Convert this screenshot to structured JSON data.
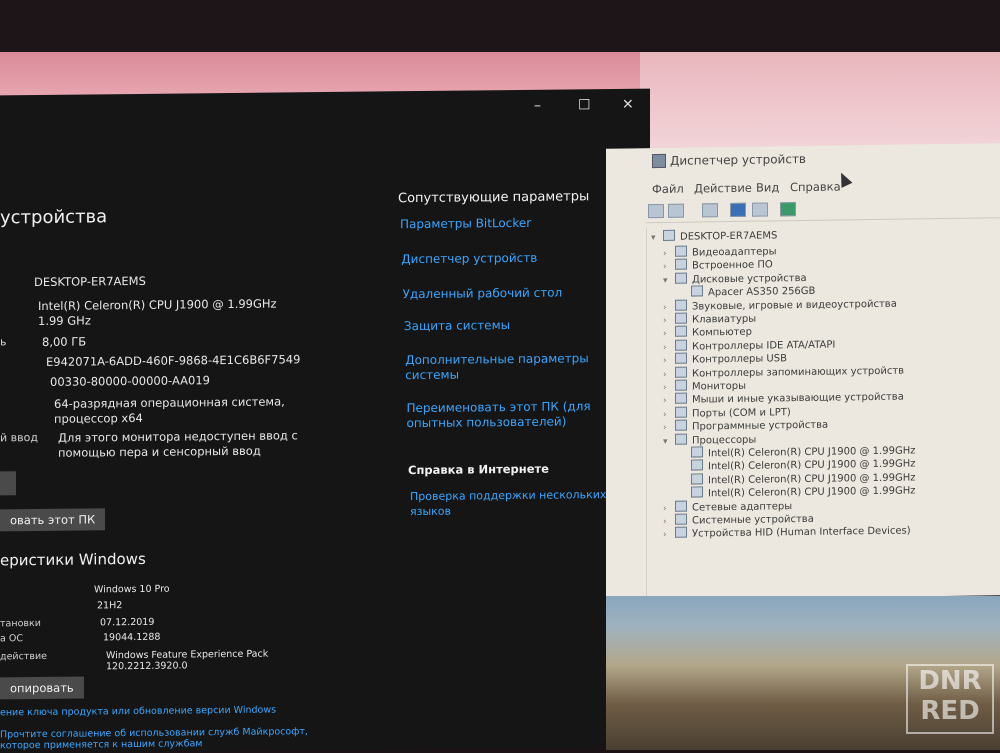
{
  "settings": {
    "title": "устройства",
    "specs": [
      {
        "label": "",
        "value": "DESKTOP-ER7AEMS"
      },
      {
        "label": "",
        "value": "Intel(R) Celeron(R) CPU  J1900  @ 1.99GHz\n1.99 GHz"
      },
      {
        "label": "ь",
        "value": "8,00 ГБ"
      },
      {
        "label": "",
        "value": "E942071A-6ADD-460F-9868-4E1C6B6F7549"
      },
      {
        "label": "",
        "value": "00330-80000-00000-AA019"
      },
      {
        "label": "",
        "value": "64-разрядная операционная система,\nпроцессор x64"
      },
      {
        "label": "й ввод",
        "value": "Для этого монитора недоступен ввод с\nпомощью пера и сенсорный ввод"
      }
    ],
    "copy_button_1": "",
    "rename_button": "овать этот ПК",
    "windows_title": "еристики Windows",
    "windows_specs": [
      {
        "label": "",
        "value": "Windows 10 Pro"
      },
      {
        "label": "",
        "value": "21H2"
      },
      {
        "label": "тановки",
        "value": "07.12.2019"
      },
      {
        "label": "а ОС",
        "value": "19044.1288"
      },
      {
        "label": "действие",
        "value": "Windows Feature Experience Pack\n120.2212.3920.0"
      }
    ],
    "copy_button_2": "опировать",
    "footer_link_1": "ение ключа продукта или обновление версии Windows",
    "footer_link_2": "Прочтите соглашение об использовании служб Майкрософт,",
    "footer_link_3": "которое применяется к нашим службам",
    "related_title": "Сопутствующие параметры",
    "related_links": [
      "Параметры BitLocker",
      "Диспетчер устройств",
      "Удаленный рабочий стол",
      "Защита системы",
      "Дополнительные параметры\nсистемы",
      "Переименовать этот ПК (для\nопытных пользователей)"
    ],
    "help_title": "Справка в Интернете",
    "help_link": "Проверка поддержки нескольких\nязыков",
    "window_controls": {
      "minimize": "–",
      "maximize": "☐",
      "close": "✕"
    }
  },
  "devmgr": {
    "title": "Диспетчер устройств",
    "menu": [
      "Файл",
      "Действие",
      "Вид",
      "Справка"
    ],
    "root": "DESKTOP-ER7AEMS",
    "tree": [
      {
        "label": "Видеоадаптеры",
        "level": 1,
        "expanded": false
      },
      {
        "label": "Встроенное ПО",
        "level": 1,
        "expanded": false
      },
      {
        "label": "Дисковые устройства",
        "level": 1,
        "expanded": true
      },
      {
        "label": "Apacer AS350 256GB",
        "level": 2,
        "expanded": false
      },
      {
        "label": "Звуковые, игровые и видеоустройства",
        "level": 1,
        "expanded": false
      },
      {
        "label": "Клавиатуры",
        "level": 1,
        "expanded": false
      },
      {
        "label": "Компьютер",
        "level": 1,
        "expanded": false
      },
      {
        "label": "Контроллеры IDE ATA/ATAPI",
        "level": 1,
        "expanded": false
      },
      {
        "label": "Контроллеры USB",
        "level": 1,
        "expanded": false
      },
      {
        "label": "Контроллеры запоминающих устройств",
        "level": 1,
        "expanded": false
      },
      {
        "label": "Мониторы",
        "level": 1,
        "expanded": false
      },
      {
        "label": "Мыши и иные указывающие устройства",
        "level": 1,
        "expanded": false
      },
      {
        "label": "Порты (COM и LPT)",
        "level": 1,
        "expanded": false
      },
      {
        "label": "Программные устройства",
        "level": 1,
        "expanded": false
      },
      {
        "label": "Процессоры",
        "level": 1,
        "expanded": true
      },
      {
        "label": "Intel(R) Celeron(R) CPU  J1900  @ 1.99GHz",
        "level": 2,
        "expanded": false
      },
      {
        "label": "Intel(R) Celeron(R) CPU  J1900  @ 1.99GHz",
        "level": 2,
        "expanded": false
      },
      {
        "label": "Intel(R) Celeron(R) CPU  J1900  @ 1.99GHz",
        "level": 2,
        "expanded": false
      },
      {
        "label": "Intel(R) Celeron(R) CPU  J1900  @ 1.99GHz",
        "level": 2,
        "expanded": false
      },
      {
        "label": "Сетевые адаптеры",
        "level": 1,
        "expanded": false
      },
      {
        "label": "Системные устройства",
        "level": 1,
        "expanded": false
      },
      {
        "label": "Устройства HID (Human Interface Devices)",
        "level": 1,
        "expanded": false
      }
    ]
  },
  "watermark": "DNR\nRED",
  "colors": {
    "link": "#3aa6ff",
    "settings_bg": "#151515",
    "devmgr_bg": "#ece8df"
  }
}
